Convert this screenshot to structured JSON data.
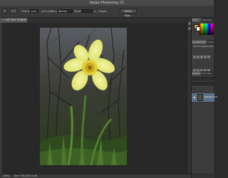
{
  "app": {
    "title": "Adobe Photoshop CC"
  },
  "options_bar": {
    "feather_label": "Feather:",
    "feather_value": "0 px",
    "antialias_label": "Anti-alias",
    "style_label": "Style:",
    "style_value": "Normal",
    "width_label": "Width:",
    "height_label": "Height:",
    "refine_edge_label": "Refine Edge..."
  },
  "document_tab": {
    "close_glyph": "×",
    "label": "d @ 100% (RGB/8*)"
  },
  "panels": {
    "color_tab": "Color",
    "swatches_tab": "Swatches",
    "adjustments_tab": "Adjustments",
    "styles_tab": "Styles",
    "add_adjustment_label": "Add an adjustment",
    "layers_tab": "Layers",
    "channels_tab": "Channels",
    "layer_name": "Background",
    "fg_color": "#d9b24a",
    "bg_color": "#ffffff"
  },
  "status_bar": {
    "zoom": "100%",
    "doc_info": "Doc: 774.4K/774.4K"
  },
  "photo": {
    "subject": "yellow daffodil flower"
  }
}
